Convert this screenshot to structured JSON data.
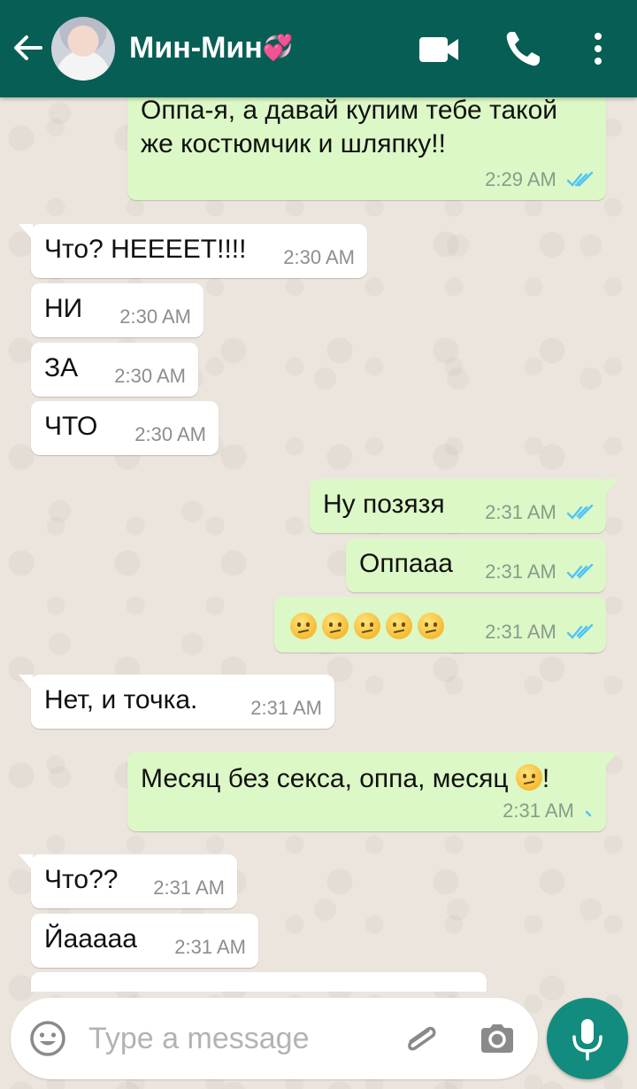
{
  "header": {
    "contact_name": "Мин-Мин",
    "name_emoji": "💞",
    "back_icon": "arrow-left-icon",
    "video_icon": "video-camera-icon",
    "call_icon": "phone-icon",
    "menu_icon": "more-vert-icon"
  },
  "messages": [
    {
      "direction": "out",
      "text": "Оппа-я, а давай купим тебе такой",
      "text2": "же костюмчик и шляпку!!",
      "time": "2:29 AM",
      "status": "read"
    },
    {
      "direction": "in",
      "text": "Что? НЕЕЕЕТ!!!!",
      "time": "2:30 AM"
    },
    {
      "direction": "in",
      "text": "НИ",
      "time": "2:30 AM"
    },
    {
      "direction": "in",
      "text": "ЗА",
      "time": "2:30 AM"
    },
    {
      "direction": "in",
      "text": "ЧТО",
      "time": "2:30 AM"
    },
    {
      "direction": "out",
      "text": "Ну позязя",
      "time": "2:31 AM",
      "status": "read"
    },
    {
      "direction": "out",
      "text": "Оппааа",
      "time": "2:31 AM",
      "status": "read"
    },
    {
      "direction": "out",
      "text": "😕😕😕😕😕",
      "time": "2:31 AM",
      "status": "read"
    },
    {
      "direction": "in",
      "text": "Нет, и точка.",
      "time": "2:31 AM"
    },
    {
      "direction": "out",
      "text": "Месяц без секса, оппа, месяц",
      "text_suffix": "!",
      "time": "2:31 AM",
      "status": "sending"
    },
    {
      "direction": "in",
      "text": "Что??",
      "time": "2:31 AM"
    },
    {
      "direction": "in",
      "text": "Йааааа",
      "time": "2:31 AM"
    }
  ],
  "input": {
    "placeholder": "Type a message",
    "emoji_icon": "emoji-icon",
    "attach_icon": "paperclip-icon",
    "camera_icon": "camera-icon",
    "mic_icon": "microphone-icon"
  },
  "colors": {
    "header": "#075e54",
    "outgoing_bubble": "#dcf8c6",
    "incoming_bubble": "#ffffff",
    "read_ticks": "#4fc3f7",
    "mic_button": "#128c7e",
    "wallpaper": "#ece5dd"
  }
}
